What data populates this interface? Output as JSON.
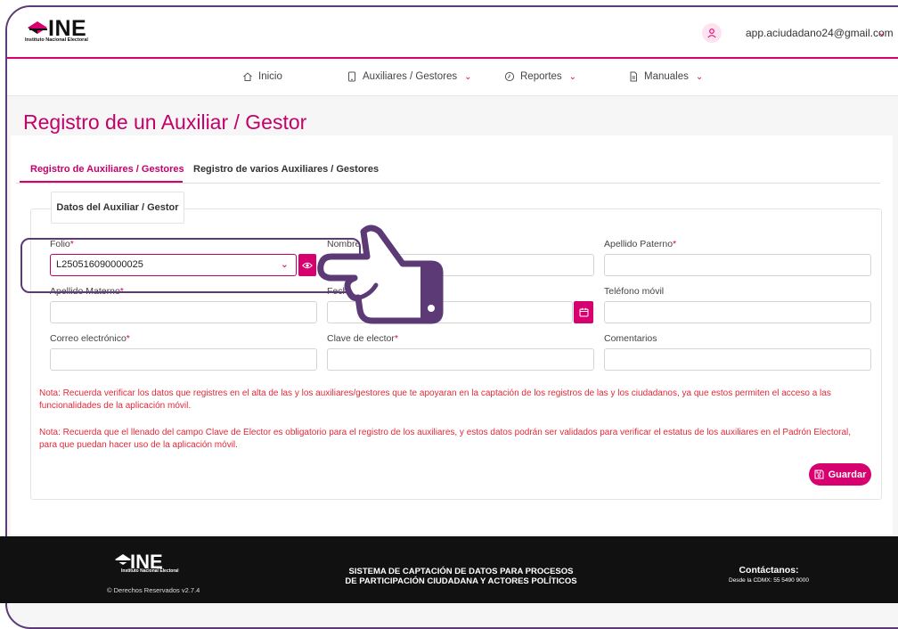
{
  "header": {
    "logo_text": "INE",
    "logo_sub": "Instituto Nacional Electoral",
    "user_email": "app.aciudadano24@gmail.com"
  },
  "nav": {
    "items": [
      {
        "label": "Inicio"
      },
      {
        "label": "Auxiliares / Gestores"
      },
      {
        "label": "Reportes"
      },
      {
        "label": "Manuales"
      }
    ]
  },
  "page": {
    "title": "Registro de un Auxiliar / Gestor"
  },
  "tabs": [
    {
      "label": "Registro de Auxiliares / Gestores",
      "active": true
    },
    {
      "label": "Registro de varios Auxiliares / Gestores",
      "active": false
    }
  ],
  "form": {
    "section_title": "Datos del Auxiliar / Gestor",
    "folio": {
      "label": "Folio",
      "value": "L250516090000025"
    },
    "nombre": {
      "label": "Nombre",
      "value": ""
    },
    "apellido_paterno": {
      "label": "Apellido Paterno",
      "value": ""
    },
    "apellido_materno": {
      "label": "Apellido Materno",
      "value": ""
    },
    "fecha": {
      "label": "Fecha",
      "value": ""
    },
    "telefono": {
      "label": "Teléfono móvil",
      "value": ""
    },
    "correo": {
      "label": "Correo electrónico",
      "value": ""
    },
    "clave": {
      "label": "Clave de elector",
      "value": ""
    },
    "comentarios": {
      "label": "Comentarios",
      "value": ""
    },
    "required_mark": "*"
  },
  "notes": [
    "Nota: Recuerda verificar los datos que registres en el alta de las y los auxiliares/gestores que te apoyaran en la captación de los registros de las y los ciudadanos, ya que estos permiten el acceso a las funcionalidades de la aplicación móvil.",
    "Nota: Recuerda que el llenado del campo Clave de Elector es obligatorio para el registro de los auxiliares, y estos datos podrán ser validados para verificar el estatus de los auxiliares en el Padrón Electoral, para que puedan hacer uso de la aplicación móvil."
  ],
  "actions": {
    "save_label": "Guardar"
  },
  "footer": {
    "logo_text": "INE",
    "logo_sub": "Instituto Nacional Electoral",
    "copyright": "© Derechos Reservados v2.7.4",
    "system_name": "SISTEMA DE CAPTACIÓN DE DATOS PARA PROCESOS DE PARTICIPACIÓN CIUDADANA Y ACTORES POLÍTICOS",
    "contact_title": "Contáctanos:",
    "contact_phone": "Desde la CDMX: 55 5490 9000"
  },
  "colors": {
    "brand": "#d6006f",
    "title": "#c4006a",
    "note": "#e0293a",
    "annotation": "#5b3a75"
  }
}
